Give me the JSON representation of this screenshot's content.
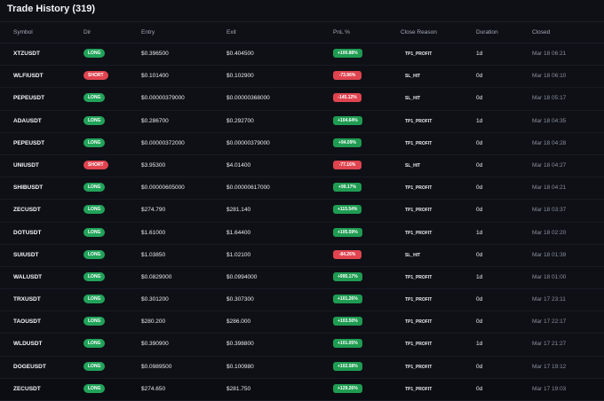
{
  "header": {
    "title": "Trade History (319)"
  },
  "columns": {
    "symbol": "Symbol",
    "dir": "Dir",
    "entry": "Entry",
    "exit": "Exit",
    "pnl": "PnL %",
    "reason": "Close Reason",
    "duration": "Duration",
    "closed": "Closed"
  },
  "colors": {
    "long": "#22a35a",
    "short": "#e0444f",
    "profit": "#1f9c52",
    "loss": "#e0444f"
  },
  "rows": [
    {
      "symbol": "XTZUSDT",
      "dir": "LONG",
      "entry": "$0.396500",
      "exit": "$0.404500",
      "pnl": "+100.88%",
      "pnl_sign": "pos",
      "reason": "TP1_PROFIT",
      "duration": "1d",
      "closed": "Mar 18 06:21"
    },
    {
      "symbol": "WLFIUSDT",
      "dir": "SHORT",
      "entry": "$0.101400",
      "exit": "$0.102900",
      "pnl": "-73.96%",
      "pnl_sign": "neg",
      "reason": "SL_HIT",
      "duration": "0d",
      "closed": "Mar 18 06:10"
    },
    {
      "symbol": "PEPEUSDT",
      "dir": "LONG",
      "entry": "$0.00000379000",
      "exit": "$0.00000368000",
      "pnl": "-145.12%",
      "pnl_sign": "neg",
      "reason": "SL_HIT",
      "duration": "0d",
      "closed": "Mar 18 05:17"
    },
    {
      "symbol": "ADAUSDT",
      "dir": "LONG",
      "entry": "$0.286700",
      "exit": "$0.292700",
      "pnl": "+104.64%",
      "pnl_sign": "pos",
      "reason": "TP1_PROFIT",
      "duration": "1d",
      "closed": "Mar 18 04:35"
    },
    {
      "symbol": "PEPEUSDT",
      "dir": "LONG",
      "entry": "$0.00000372000",
      "exit": "$0.00000379000",
      "pnl": "+94.09%",
      "pnl_sign": "pos",
      "reason": "TP1_PROFIT",
      "duration": "0d",
      "closed": "Mar 18 04:28"
    },
    {
      "symbol": "UNIUSDT",
      "dir": "SHORT",
      "entry": "$3.95300",
      "exit": "$4.01400",
      "pnl": "-77.16%",
      "pnl_sign": "neg",
      "reason": "SL_HIT",
      "duration": "0d",
      "closed": "Mar 18 04:27"
    },
    {
      "symbol": "SHIBUSDT",
      "dir": "LONG",
      "entry": "$0.00000605000",
      "exit": "$0.00000617000",
      "pnl": "+99.17%",
      "pnl_sign": "pos",
      "reason": "TP1_PROFIT",
      "duration": "0d",
      "closed": "Mar 18 04:21"
    },
    {
      "symbol": "ZECUSDT",
      "dir": "LONG",
      "entry": "$274.790",
      "exit": "$281.140",
      "pnl": "+115.54%",
      "pnl_sign": "pos",
      "reason": "TP1_PROFIT",
      "duration": "0d",
      "closed": "Mar 18 03:37"
    },
    {
      "symbol": "DOTUSDT",
      "dir": "LONG",
      "entry": "$1.61000",
      "exit": "$1.64400",
      "pnl": "+105.59%",
      "pnl_sign": "pos",
      "reason": "TP1_PROFIT",
      "duration": "1d",
      "closed": "Mar 18 02:20"
    },
    {
      "symbol": "SUIUSDT",
      "dir": "LONG",
      "entry": "$1.03850",
      "exit": "$1.02100",
      "pnl": "-84.26%",
      "pnl_sign": "neg",
      "reason": "SL_HIT",
      "duration": "0d",
      "closed": "Mar 18 01:39"
    },
    {
      "symbol": "WALUSDT",
      "dir": "LONG",
      "entry": "$0.0829000",
      "exit": "$0.0994000",
      "pnl": "+995.17%",
      "pnl_sign": "pos",
      "reason": "TP1_PROFIT",
      "duration": "1d",
      "closed": "Mar 18 01:00"
    },
    {
      "symbol": "TRXUSDT",
      "dir": "LONG",
      "entry": "$0.301200",
      "exit": "$0.307300",
      "pnl": "+101.26%",
      "pnl_sign": "pos",
      "reason": "TP1_PROFIT",
      "duration": "0d",
      "closed": "Mar 17 23:11"
    },
    {
      "symbol": "TAOUSDT",
      "dir": "LONG",
      "entry": "$280.200",
      "exit": "$286.000",
      "pnl": "+103.50%",
      "pnl_sign": "pos",
      "reason": "TP1_PROFIT",
      "duration": "0d",
      "closed": "Mar 17 22:17"
    },
    {
      "symbol": "WLDUSDT",
      "dir": "LONG",
      "entry": "$0.390900",
      "exit": "$0.398800",
      "pnl": "+101.05%",
      "pnl_sign": "pos",
      "reason": "TP1_PROFIT",
      "duration": "1d",
      "closed": "Mar 17 21:27"
    },
    {
      "symbol": "DOGEUSDT",
      "dir": "LONG",
      "entry": "$0.0989500",
      "exit": "$0.100980",
      "pnl": "+102.58%",
      "pnl_sign": "pos",
      "reason": "TP1_PROFIT",
      "duration": "0d",
      "closed": "Mar 17 19:12"
    },
    {
      "symbol": "ZECUSDT",
      "dir": "LONG",
      "entry": "$274.650",
      "exit": "$281.750",
      "pnl": "+129.26%",
      "pnl_sign": "pos",
      "reason": "TP1_PROFIT",
      "duration": "0d",
      "closed": "Mar 17 19:03"
    }
  ]
}
